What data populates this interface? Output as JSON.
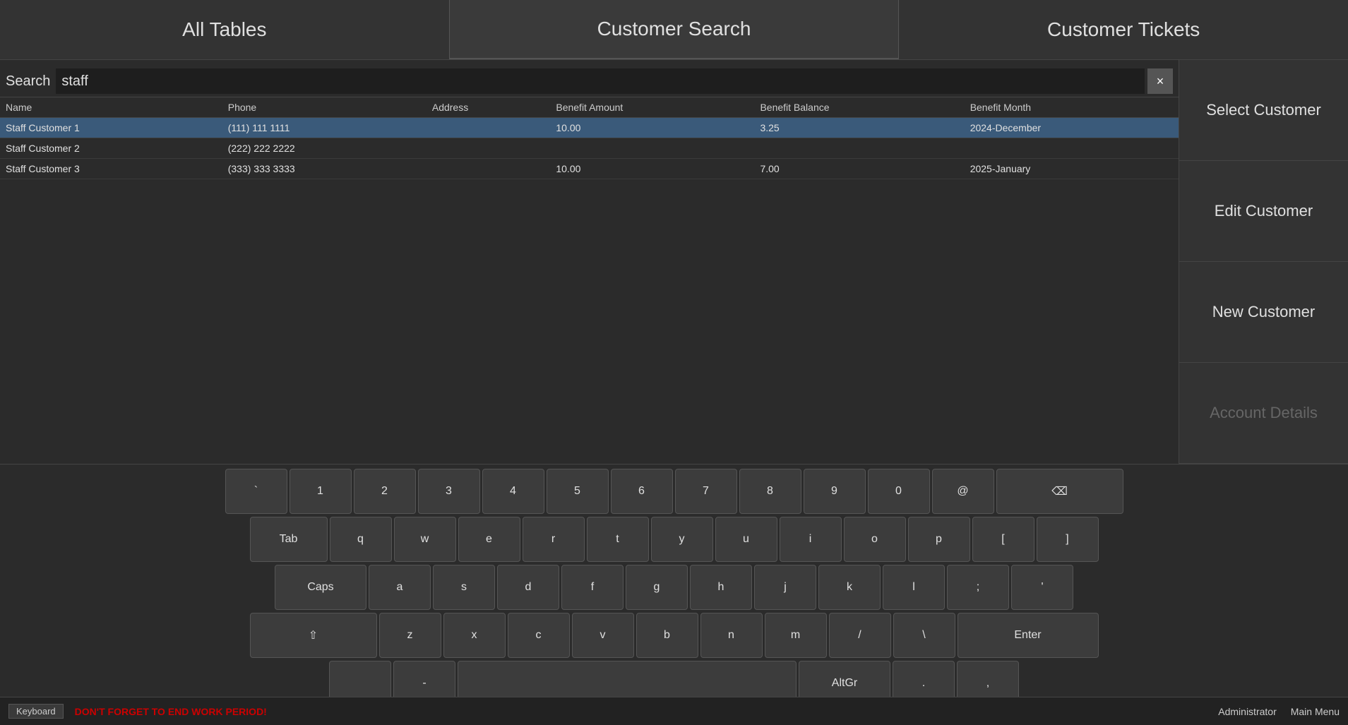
{
  "nav": {
    "tabs": [
      {
        "id": "all-tables",
        "label": "All Tables",
        "active": false
      },
      {
        "id": "customer-search",
        "label": "Customer Search",
        "active": true
      },
      {
        "id": "customer-tickets",
        "label": "Customer Tickets",
        "active": false
      }
    ]
  },
  "search": {
    "label": "Search",
    "value": "staff",
    "placeholder": "",
    "clear_label": "×"
  },
  "table": {
    "columns": [
      {
        "id": "name",
        "label": "Name"
      },
      {
        "id": "phone",
        "label": "Phone"
      },
      {
        "id": "address",
        "label": "Address"
      },
      {
        "id": "benefit_amount",
        "label": "Benefit Amount"
      },
      {
        "id": "benefit_balance",
        "label": "Benefit Balance"
      },
      {
        "id": "benefit_month",
        "label": "Benefit Month"
      }
    ],
    "rows": [
      {
        "name": "Staff Customer 1",
        "phone": "(111) 111 1111",
        "address": "",
        "benefit_amount": "10.00",
        "benefit_balance": "3.25",
        "benefit_month": "2024-December",
        "selected": true
      },
      {
        "name": "Staff Customer 2",
        "phone": "(222) 222 2222",
        "address": "",
        "benefit_amount": "",
        "benefit_balance": "",
        "benefit_month": "",
        "selected": false
      },
      {
        "name": "Staff Customer 3",
        "phone": "(333) 333 3333",
        "address": "",
        "benefit_amount": "10.00",
        "benefit_balance": "7.00",
        "benefit_month": "2025-January",
        "selected": false
      }
    ]
  },
  "sidebar": {
    "buttons": [
      {
        "id": "select-customer",
        "label": "Select Customer",
        "disabled": false
      },
      {
        "id": "edit-customer",
        "label": "Edit Customer",
        "disabled": false
      },
      {
        "id": "new-customer",
        "label": "New Customer",
        "disabled": false
      },
      {
        "id": "account-details",
        "label": "Account Details",
        "disabled": true
      }
    ]
  },
  "keyboard": {
    "rows": [
      {
        "keys": [
          {
            "label": "`",
            "id": "backtick"
          },
          {
            "label": "1",
            "id": "1"
          },
          {
            "label": "2",
            "id": "2"
          },
          {
            "label": "3",
            "id": "3"
          },
          {
            "label": "4",
            "id": "4"
          },
          {
            "label": "5",
            "id": "5"
          },
          {
            "label": "6",
            "id": "6"
          },
          {
            "label": "7",
            "id": "7"
          },
          {
            "label": "8",
            "id": "8"
          },
          {
            "label": "9",
            "id": "9"
          },
          {
            "label": "0",
            "id": "0"
          },
          {
            "label": "@",
            "id": "at"
          },
          {
            "label": "⌫",
            "id": "backspace",
            "class": "wider backspace"
          }
        ]
      },
      {
        "keys": [
          {
            "label": "Tab",
            "id": "tab",
            "class": "tab"
          },
          {
            "label": "q",
            "id": "q"
          },
          {
            "label": "w",
            "id": "w"
          },
          {
            "label": "e",
            "id": "e"
          },
          {
            "label": "r",
            "id": "r"
          },
          {
            "label": "t",
            "id": "t"
          },
          {
            "label": "y",
            "id": "y"
          },
          {
            "label": "u",
            "id": "u"
          },
          {
            "label": "i",
            "id": "i"
          },
          {
            "label": "o",
            "id": "o"
          },
          {
            "label": "p",
            "id": "p"
          },
          {
            "label": "[",
            "id": "lbracket"
          },
          {
            "label": "]",
            "id": "rbracket"
          }
        ]
      },
      {
        "keys": [
          {
            "label": "Caps",
            "id": "caps",
            "class": "caps"
          },
          {
            "label": "a",
            "id": "a"
          },
          {
            "label": "s",
            "id": "s"
          },
          {
            "label": "d",
            "id": "d"
          },
          {
            "label": "f",
            "id": "f"
          },
          {
            "label": "g",
            "id": "g"
          },
          {
            "label": "h",
            "id": "h"
          },
          {
            "label": "j",
            "id": "j"
          },
          {
            "label": "k",
            "id": "k"
          },
          {
            "label": "l",
            "id": "l"
          },
          {
            "label": ";",
            "id": "semicolon"
          },
          {
            "label": "'",
            "id": "quote"
          }
        ]
      },
      {
        "keys": [
          {
            "label": "⇧",
            "id": "shift",
            "class": "wider"
          },
          {
            "label": "z",
            "id": "z"
          },
          {
            "label": "x",
            "id": "x"
          },
          {
            "label": "c",
            "id": "c"
          },
          {
            "label": "v",
            "id": "v"
          },
          {
            "label": "b",
            "id": "b"
          },
          {
            "label": "n",
            "id": "n"
          },
          {
            "label": "m",
            "id": "m"
          },
          {
            "label": "/",
            "id": "slash"
          },
          {
            "label": "\\",
            "id": "backslash"
          },
          {
            "label": "Enter",
            "id": "enter",
            "class": "enter"
          }
        ]
      },
      {
        "keys": [
          {
            "label": "",
            "id": "fn1"
          },
          {
            "label": "-",
            "id": "minus"
          },
          {
            "label": "",
            "id": "space",
            "class": "widest"
          },
          {
            "label": "AltGr",
            "id": "altgr",
            "class": "altgr"
          },
          {
            "label": ".",
            "id": "period"
          },
          {
            "label": ",",
            "id": "comma"
          }
        ]
      }
    ]
  },
  "status_bar": {
    "keyboard_label": "Keyboard",
    "warning_text": "DON'T FORGET TO END WORK PERIOD!",
    "admin_label": "Administrator",
    "main_menu_label": "Main Menu"
  }
}
